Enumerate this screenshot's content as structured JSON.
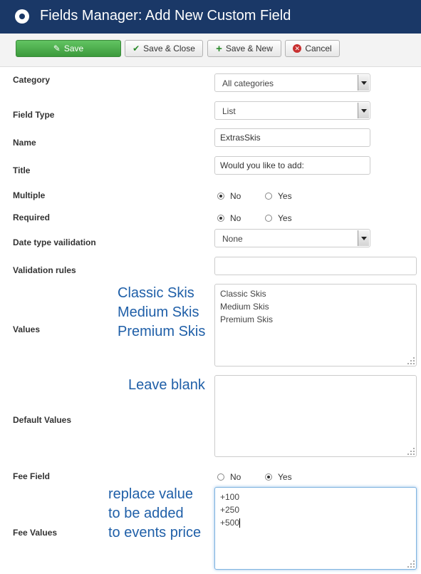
{
  "header": {
    "title": "Fields Manager: Add New Custom Field"
  },
  "toolbar": {
    "save": "Save",
    "save_close": "Save & Close",
    "save_new": "Save & New",
    "cancel": "Cancel"
  },
  "form": {
    "category": {
      "label": "Category",
      "value": "All categories"
    },
    "field_type": {
      "label": "Field Type",
      "value": "List"
    },
    "name": {
      "label": "Name",
      "value": "ExtrasSkis"
    },
    "title": {
      "label": "Title",
      "value": "Would you like to add:"
    },
    "multiple": {
      "label": "Multiple",
      "options": [
        "No",
        "Yes"
      ],
      "selected": "No"
    },
    "required": {
      "label": "Required",
      "options": [
        "No",
        "Yes"
      ],
      "selected": "No"
    },
    "date_validation": {
      "label": "Date type vailidation",
      "value": "None"
    },
    "validation_rules": {
      "label": "Validation rules",
      "value": ""
    },
    "values": {
      "label": "Values",
      "lines": [
        "Classic Skis",
        "Medium Skis",
        "Premium Skis"
      ]
    },
    "default_values": {
      "label": "Default Values",
      "value": ""
    },
    "fee_field": {
      "label": "Fee Field",
      "options": [
        "No",
        "Yes"
      ],
      "selected": "Yes"
    },
    "fee_values": {
      "label": "Fee Values",
      "lines": [
        "+100",
        "+250",
        "+500"
      ]
    }
  },
  "annotations": {
    "values_note": [
      "Classic Skis",
      "Medium Skis",
      "Premium Skis"
    ],
    "default_note": "Leave blank",
    "fee_note": [
      "replace value",
      "to be added",
      "to events price"
    ]
  },
  "colors": {
    "header_bg": "#1a3867",
    "save_green": "#4aa84a",
    "annotation_blue": "#1f5fa8",
    "cancel_red": "#c83030"
  }
}
